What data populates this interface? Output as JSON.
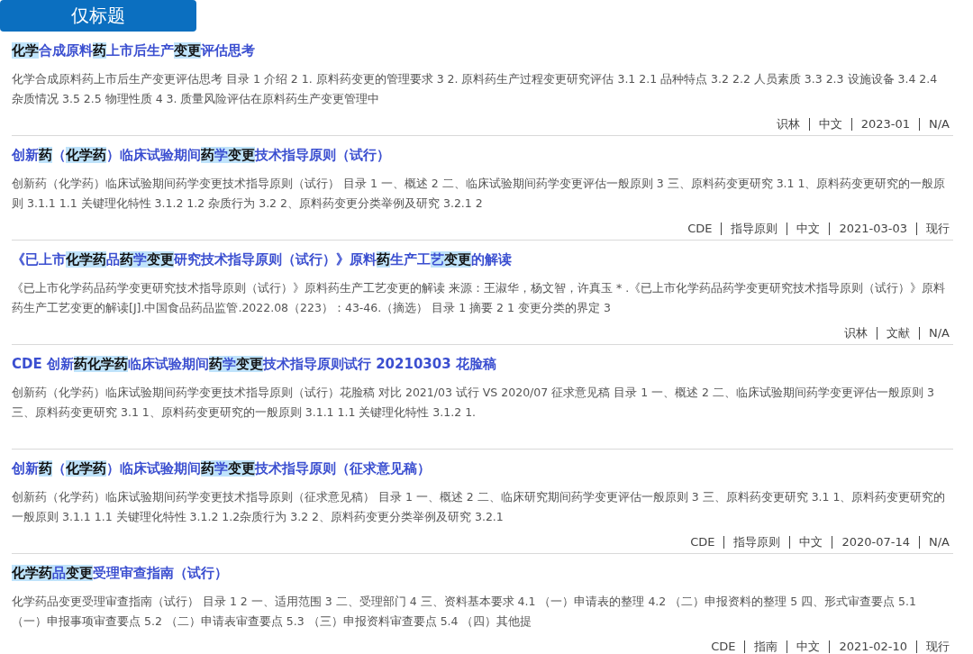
{
  "header_tab": {
    "label": "仅标题",
    "selected": true
  },
  "results": [
    {
      "title": [
        {
          "text": "化学",
          "kind": "match"
        },
        {
          "text": "合成原料",
          "kind": "text"
        },
        {
          "text": "药",
          "kind": "match"
        },
        {
          "text": "上市后生产",
          "kind": "text"
        },
        {
          "text": "变更",
          "kind": "match"
        },
        {
          "text": "评估思考",
          "kind": "text"
        }
      ],
      "snippet": "化学合成原料药上市后生产变更评估思考 目录 1 介绍 2 1. 原料药变更的管理要求 3 2. 原料药生产过程变更研究评估 3.1 2.1 品种特点 3.2 2.2 人员素质 3.3 2.3 设施设备 3.4 2.4 杂质情况 3.5 2.5 物理性质 4 3. 质量风险评估在原料药生产变更管理中",
      "meta": [
        "识林",
        "中文",
        "2023-01",
        "N/A"
      ]
    },
    {
      "title": [
        {
          "text": "创新",
          "kind": "text"
        },
        {
          "text": "药",
          "kind": "match"
        },
        {
          "text": "（",
          "kind": "text"
        },
        {
          "text": "化学药",
          "kind": "match"
        },
        {
          "text": "）临床试验期间",
          "kind": "text"
        },
        {
          "text": "药",
          "kind": "match"
        },
        {
          "text": "学",
          "kind": "hint"
        },
        {
          "text": "变更",
          "kind": "match"
        },
        {
          "text": "技术指导原则（试行）",
          "kind": "text"
        }
      ],
      "snippet": "创新药（化学药）临床试验期间药学变更技术指导原则（试行） 目录 1 一、概述 2 二、临床试验期间药学变更评估一般原则 3 三、原料药变更研究 3.1 1、原料药变更研究的一般原则 3.1.1 1.1 关键理化特性 3.1.2 1.2 杂质行为 3.2 2、原料药变更分类举例及研究 3.2.1 2",
      "meta": [
        "CDE",
        "指导原则",
        "中文",
        "2021-03-03",
        "现行"
      ]
    },
    {
      "title": [
        {
          "text": "《已上市",
          "kind": "text"
        },
        {
          "text": "化学药",
          "kind": "match"
        },
        {
          "text": "品",
          "kind": "text"
        },
        {
          "text": "药",
          "kind": "match"
        },
        {
          "text": "学",
          "kind": "hint"
        },
        {
          "text": "变更",
          "kind": "match"
        },
        {
          "text": "研究技术指导原则（试行）》原料",
          "kind": "text"
        },
        {
          "text": "药",
          "kind": "match"
        },
        {
          "text": "生产工",
          "kind": "text"
        },
        {
          "text": "艺",
          "kind": "hint"
        },
        {
          "text": "变更",
          "kind": "match"
        },
        {
          "text": "的解读",
          "kind": "text"
        }
      ],
      "snippet": "《已上市化学药品药学变更研究技术指导原则（试行）》原料药生产工艺变更的解读 来源：王淑华，杨文智，许真玉 * .《已上市化学药品药学变更研究技术指导原则（试行）》原料药生产工艺变更的解读[J].中国食品药品监管.2022.08（223）：43-46.（摘选） 目录 1 摘要 2 1 变更分类的界定 3",
      "meta": [
        "识林",
        "文献",
        "N/A"
      ]
    },
    {
      "title": [
        {
          "text": "CDE 创新",
          "kind": "text"
        },
        {
          "text": "药化学药",
          "kind": "match"
        },
        {
          "text": "临床试验期间",
          "kind": "text"
        },
        {
          "text": "药",
          "kind": "match"
        },
        {
          "text": "学",
          "kind": "hint"
        },
        {
          "text": "变更",
          "kind": "match"
        },
        {
          "text": "技术指导原则试行 20210303 花脸稿",
          "kind": "text"
        }
      ],
      "snippet": "创新药（化学药）临床试验期间药学变更技术指导原则（试行）花脸稿 对比 2021/03 试行 VS 2020/07 征求意见稿 目录 1 一、概述 2 二、临床试验期间药学变更评估一般原则 3 三、原料药变更研究 3.1 1、原料药变更研究的一般原则 3.1.1 1.1 关键理化特性 3.1.2 1."
    },
    {
      "title": [
        {
          "text": "创新",
          "kind": "text"
        },
        {
          "text": "药",
          "kind": "match"
        },
        {
          "text": "（",
          "kind": "text"
        },
        {
          "text": "化学药",
          "kind": "match"
        },
        {
          "text": "）临床试验期间",
          "kind": "text"
        },
        {
          "text": "药",
          "kind": "match"
        },
        {
          "text": "学",
          "kind": "hint"
        },
        {
          "text": "变更",
          "kind": "match"
        },
        {
          "text": "技术指导原则（征求意见稿）",
          "kind": "text"
        }
      ],
      "snippet": "创新药（化学药）临床试验期间药学变更技术指导原则（征求意见稿） 目录 1 一、概述 2 二、临床研究期间药学变更评估一般原则 3 三、原料药变更研究 3.1 1、原料药变更研究的一般原则 3.1.1 1.1 关键理化特性 3.1.2 1.2杂质行为 3.2 2、原料药变更分类举例及研究 3.2.1",
      "meta": [
        "CDE",
        "指导原则",
        "中文",
        "2020-07-14",
        "N/A"
      ]
    },
    {
      "title": [
        {
          "text": "化学药",
          "kind": "match"
        },
        {
          "text": "品",
          "kind": "hint"
        },
        {
          "text": "变更",
          "kind": "match"
        },
        {
          "text": "受理审查指南（试行）",
          "kind": "text"
        }
      ],
      "snippet": "化学药品变更受理审查指南（试行） 目录 1 2 一、适用范围 3 二、受理部门 4 三、资料基本要求 4.1 （一）申请表的整理 4.2 （二）申报资料的整理 5 四、形式审查要点 5.1 （一）申报事项审查要点 5.2 （二）申请表审查要点 5.3 （三）申报资料审查要点 5.4 （四）其他提",
      "meta": [
        "CDE",
        "指南",
        "中文",
        "2021-02-10",
        "现行"
      ]
    }
  ]
}
